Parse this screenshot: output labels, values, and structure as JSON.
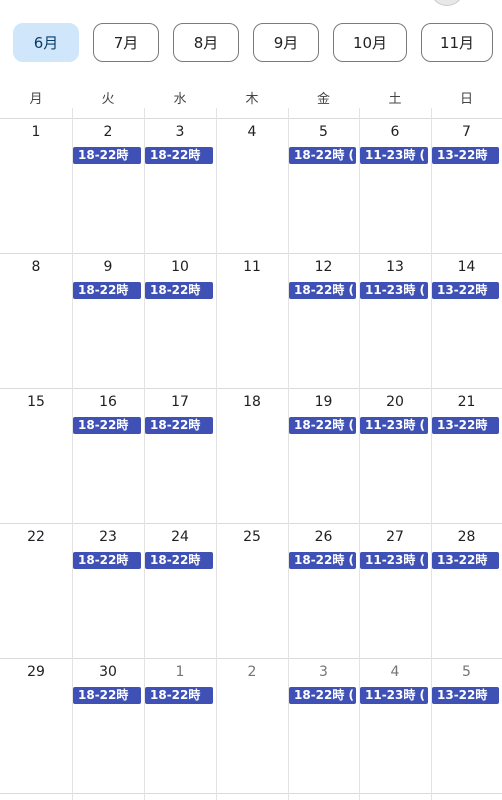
{
  "months": [
    "6月",
    "7月",
    "8月",
    "9月",
    "10月",
    "11月"
  ],
  "active_month": "6月",
  "weekdays": [
    "月",
    "火",
    "水",
    "木",
    "金",
    "土",
    "日"
  ],
  "weeks": [
    {
      "days": [
        "1",
        "2",
        "3",
        "4",
        "5",
        "6",
        "7"
      ],
      "other_month": [
        false,
        false,
        false,
        false,
        false,
        false,
        false
      ]
    },
    {
      "days": [
        "8",
        "9",
        "10",
        "11",
        "12",
        "13",
        "14"
      ],
      "other_month": [
        false,
        false,
        false,
        false,
        false,
        false,
        false
      ]
    },
    {
      "days": [
        "15",
        "16",
        "17",
        "18",
        "19",
        "20",
        "21"
      ],
      "other_month": [
        false,
        false,
        false,
        false,
        false,
        false,
        false
      ]
    },
    {
      "days": [
        "22",
        "23",
        "24",
        "25",
        "26",
        "27",
        "28"
      ],
      "other_month": [
        false,
        false,
        false,
        false,
        false,
        false,
        false
      ]
    },
    {
      "days": [
        "29",
        "30",
        "1",
        "2",
        "3",
        "4",
        "5"
      ],
      "other_month": [
        false,
        false,
        true,
        true,
        true,
        true,
        true
      ]
    }
  ],
  "weekly_events": [
    "",
    "18-22時",
    "18-22時",
    "",
    "18-22時 (",
    "11-23時 (",
    "13-22時"
  ],
  "colors": {
    "event_bg": "#3f51b5",
    "active_tab_bg": "#cfe6fb",
    "tab_border": "#7a7a7a",
    "grid_line": "#dadada"
  }
}
